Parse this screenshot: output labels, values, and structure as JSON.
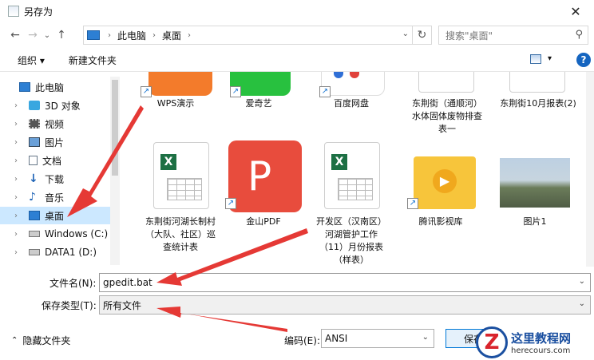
{
  "window": {
    "title": "另存为",
    "close": "✕"
  },
  "nav": {
    "back": "←",
    "forward": "→",
    "recent": "⌄",
    "up": "↑",
    "breadcrumb": [
      "此电脑",
      "桌面"
    ],
    "refresh": "↻",
    "search_placeholder": "搜索\"桌面\""
  },
  "toolbar": {
    "organize": "组织 ▾",
    "new_folder": "新建文件夹",
    "help": "?"
  },
  "sidebar": {
    "items": [
      {
        "label": "此电脑",
        "icon": "pc-icon"
      },
      {
        "label": "3D 对象",
        "icon": "cube-icon"
      },
      {
        "label": "视频",
        "icon": "video-icon"
      },
      {
        "label": "图片",
        "icon": "picture-icon"
      },
      {
        "label": "文档",
        "icon": "document-icon"
      },
      {
        "label": "下载",
        "icon": "download-icon"
      },
      {
        "label": "音乐",
        "icon": "music-icon"
      },
      {
        "label": "桌面",
        "icon": "desktop-icon",
        "selected": true
      },
      {
        "label": "Windows (C:)",
        "icon": "drive-icon"
      },
      {
        "label": "DATA1 (D:)",
        "icon": "drive-icon"
      }
    ]
  },
  "files": [
    {
      "label": "WPS演示"
    },
    {
      "label": "爱奇艺"
    },
    {
      "label": "百度网盘"
    },
    {
      "label": "东荆街（通顺河）水体固体废物排查表一"
    },
    {
      "label": "东荆街10月报表(2)"
    },
    {
      "label": "东荆街河湖长制村（大队、社区）巡查统计表"
    },
    {
      "label": "金山PDF"
    },
    {
      "label": "开发区（汉南区）河湖管护工作（11）月份报表（样表）"
    },
    {
      "label": "腾讯影视库"
    },
    {
      "label": "图片1"
    }
  ],
  "form": {
    "filename_label": "文件名(N):",
    "filename_value": "gpedit.bat",
    "filetype_label": "保存类型(T):",
    "filetype_value": "所有文件"
  },
  "bottom": {
    "hide_folders": "隐藏文件夹",
    "encoding_label": "编码(E):",
    "encoding_value": "ANSI",
    "save": "保存"
  },
  "watermark": {
    "cn": "这里教程网",
    "en": "herecours.com",
    "logo_letter": "Z"
  },
  "colors": {
    "accent": "#0078d7",
    "selected_bg": "#cce8ff",
    "annotation_arrow": "#e53935"
  }
}
